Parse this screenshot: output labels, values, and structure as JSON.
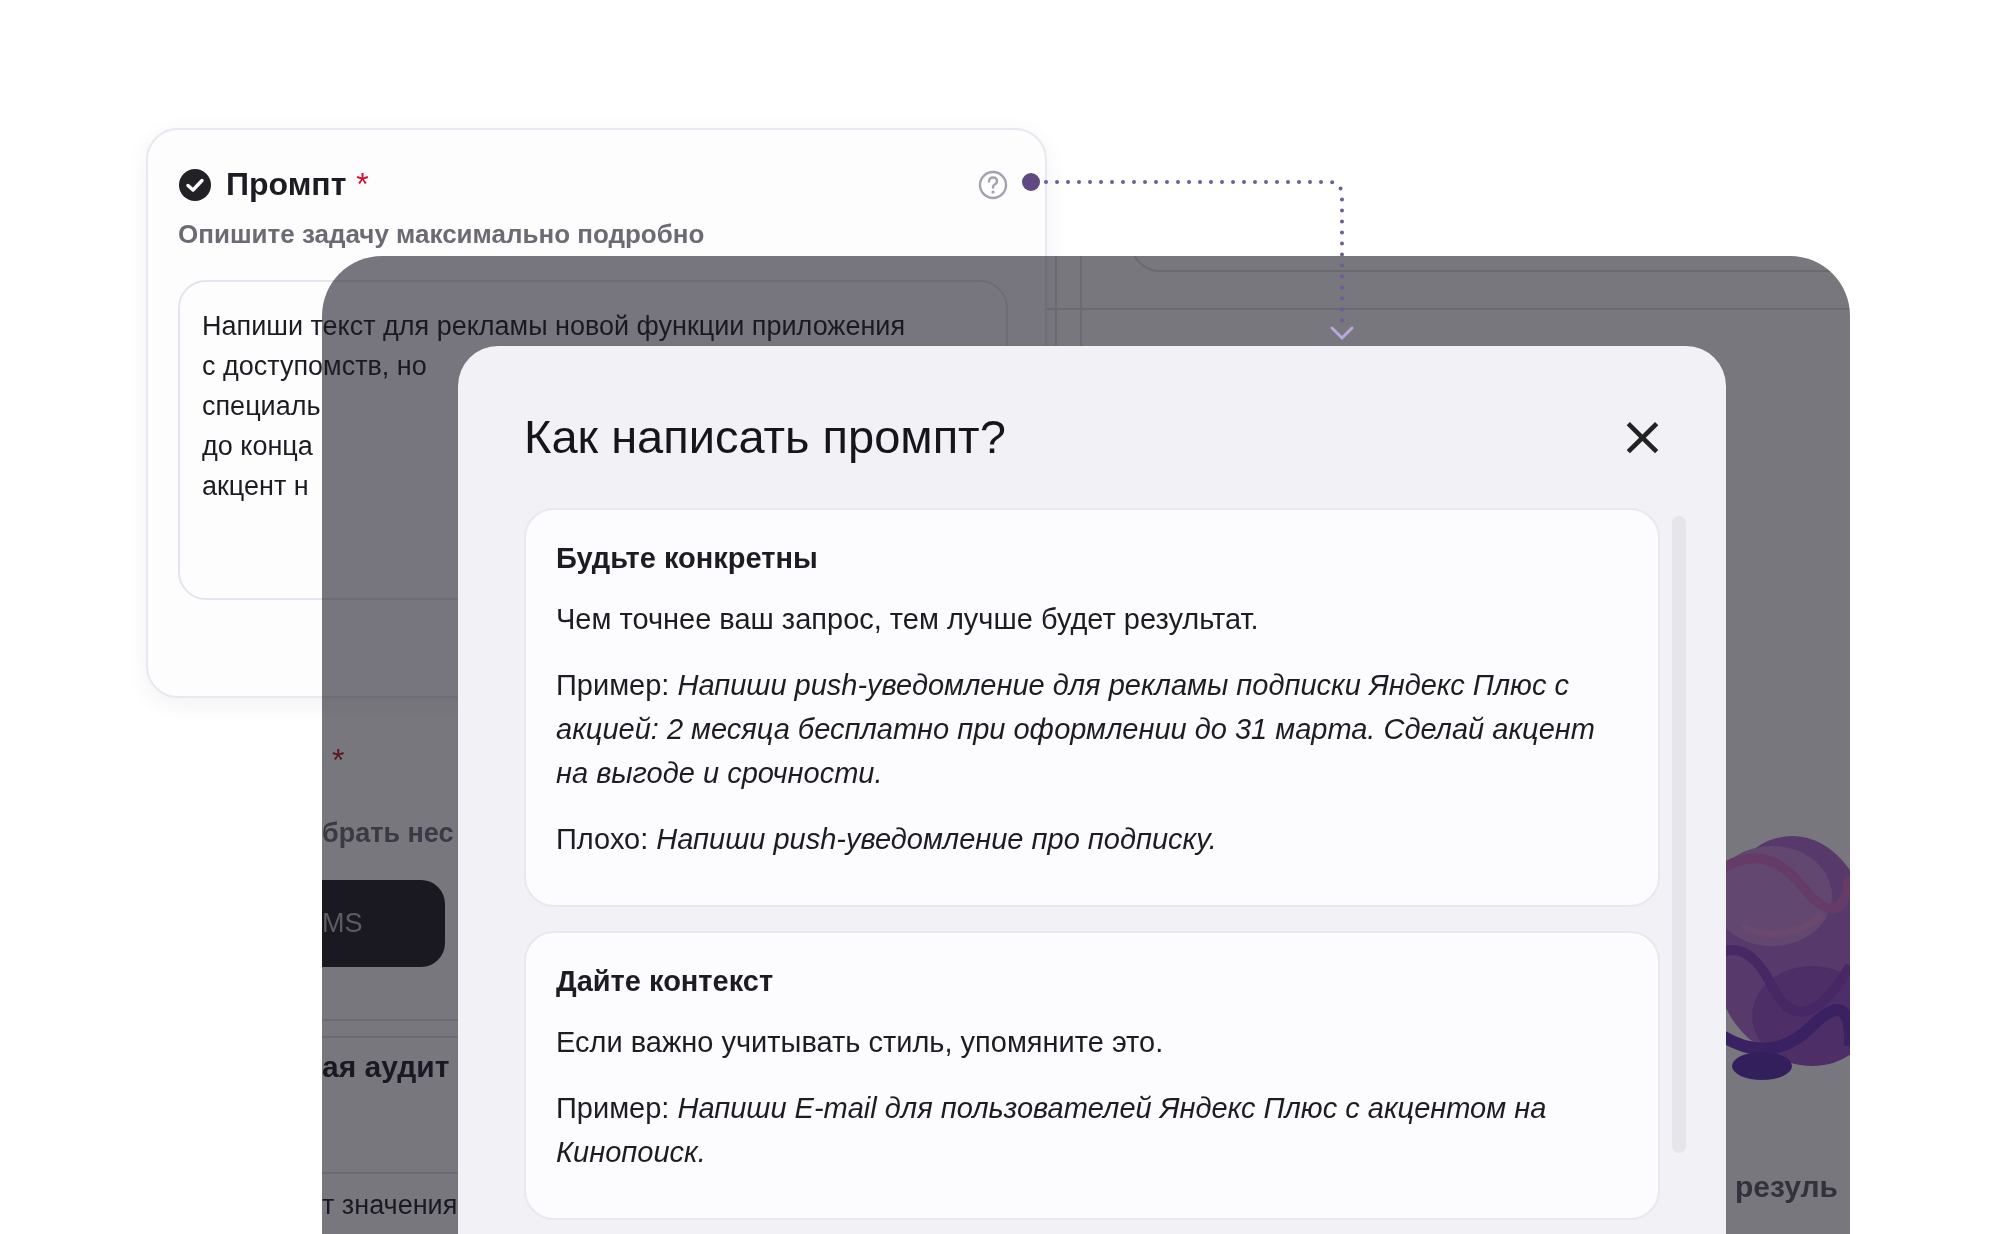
{
  "prompt_card": {
    "checked": true,
    "title": "Промпт",
    "required_mark": "*",
    "subtitle": "Опишите задачу максимально подробно",
    "value": "Напиши текст для рекламы новой функции приложения\nс доступомств, но\nспециаль\nдо конца\nакцент н"
  },
  "background_window": {
    "required_mark": "*",
    "hint": "брать нес",
    "button": "MS",
    "heading": "ая аудит",
    "label": "т значения",
    "side_text": "резуль"
  },
  "modal": {
    "title": "Как написать промпт?",
    "close": "×",
    "sections": [
      {
        "heading": "Будьте конкретны",
        "text": "Чем точнее ваш запрос, тем лучше будет результат.",
        "example": "Пример: *Напиши push-уведомление для рекламы подписки Яндекс Плюс с акцией: 2 месяца бесплатно при оформлении до 31 марта. Сделай акцент на выгоде и срочности.*",
        "bad": "Плохо: *Напиши push-уведомление про подписку.*"
      },
      {
        "heading": "Дайте контекст",
        "text": "Если важно учитывать стиль, упомяните это.",
        "example": "Пример: *Напиши E-mail для пользователей Яндекс Плюс с акцентом на Кинопоиск.*"
      }
    ]
  }
}
